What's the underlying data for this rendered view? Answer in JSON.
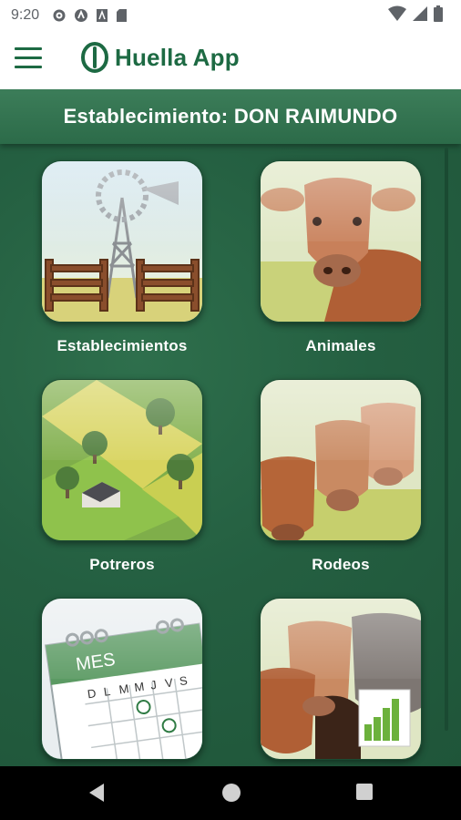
{
  "status_bar": {
    "time": "9:20"
  },
  "app_bar": {
    "title": "Huella App",
    "menu_icon": "hamburger-menu-icon"
  },
  "establishment": {
    "label": "Establecimiento: DON RAIMUNDO"
  },
  "tiles": [
    {
      "label": "Establecimientos",
      "icon": "windmill-gate-icon"
    },
    {
      "label": "Animales",
      "icon": "cow-icon"
    },
    {
      "label": "Potreros",
      "icon": "fields-icon"
    },
    {
      "label": "Rodeos",
      "icon": "herd-icon"
    },
    {
      "label": "",
      "icon": "calendar-icon",
      "calendar": {
        "month": "MES",
        "days": [
          "D",
          "L",
          "M",
          "M",
          "J",
          "V",
          "S"
        ]
      }
    },
    {
      "label": "",
      "icon": "herd-report-icon"
    }
  ],
  "colors": {
    "brand_green": "#1d6a43",
    "background_green": "#235c3f",
    "header_green": "#3c7d59"
  }
}
